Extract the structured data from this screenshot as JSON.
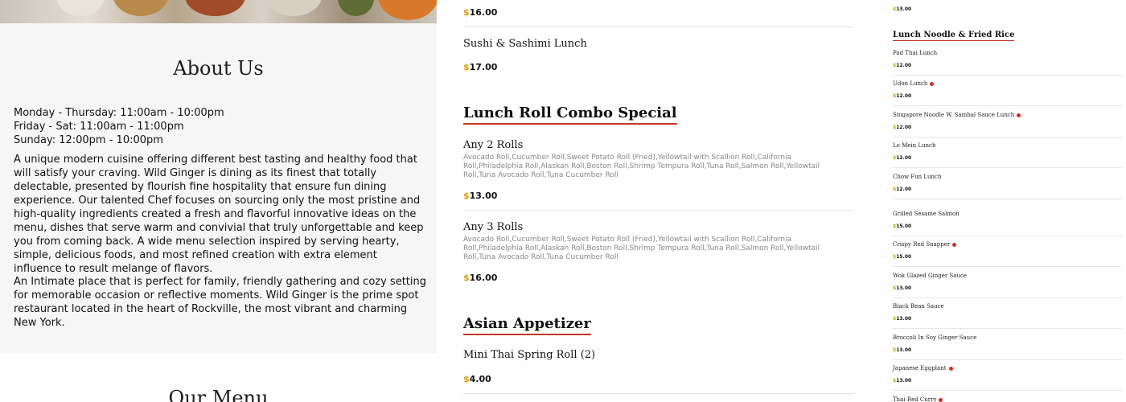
{
  "about": {
    "title": "About Us",
    "hours": [
      "Monday - Thursday: 11:00am - 10:00pm",
      "Friday - Sat: 11:00am - 11:00pm",
      "Sunday: 12:00pm - 10:00pm"
    ],
    "paragraph1": "A unique modern cuisine offering different best tasting and healthy food that will satisfy your craving. Wild Ginger is dining as its finest that totally delectable, presented by flourish fine hospitality that ensure fun dining experience. Our talented Chef focuses on sourcing only the most pristine and high-quality ingredients created a fresh and flavorful innovative ideas on the menu, dishes that serve warm and convivial that truly unforgettable and keep you from coming back. A wide menu selection inspired by serving hearty, simple, delicious foods, and most refined creation with extra element influence to result melange of flavors.",
    "paragraph2": "An Intimate place that is perfect for family, friendly gathering and cozy setting for memorable occasion or reflective moments. Wild Ginger is the prime spot restaurant located in the heart of Rockville, the most vibrant and charming New York."
  },
  "our_menu_title": "Our Menu",
  "currency": "$",
  "middle": {
    "top_price": "16.00",
    "sushi_item": {
      "name": "Sushi & Sashimi Lunch",
      "price": "17.00"
    },
    "roll_combo": {
      "title": "Lunch Roll Combo Special",
      "items": [
        {
          "name": "Any 2 Rolls",
          "desc": "Avocado Roll,Cucumber Roll,Sweet Potato Roll (Fried),Yellowtail with Scallion Roll,California Roll,Philadelphia Roll,Alaskan Roll,Boston Roll,Shrimp Tempura Roll,Tuna Roll,Salmon Roll,Yellowtail Roll,Tuna Avocado Roll,Tuna Cucumber Roll",
          "price": "13.00"
        },
        {
          "name": "Any 3 Rolls",
          "desc": "Avocado Roll,Cucumber Roll,Sweet Potato Roll (Fried),Yellowtail with Scallion Roll,California Roll,Philadelphia Roll,Alaskan Roll,Boston Roll,Shrimp Tempura Roll,Tuna Roll,Salmon Roll,Yellowtail Roll,Tuna Avocado Roll,Tuna Cucumber Roll",
          "price": "16.00"
        }
      ]
    },
    "appetizer": {
      "title": "Asian Appetizer",
      "items": [
        {
          "name": "Mini Thai Spring Roll (2)",
          "price": "4.00"
        }
      ]
    }
  },
  "right": {
    "top_price": "13.00",
    "section_title": "Lunch Noodle & Fried Rice",
    "items": [
      {
        "name": "Pad Thai Lunch",
        "price": "12.00",
        "spicy": false
      },
      {
        "name": "Udon Lunch",
        "price": "12.00",
        "spicy": true
      },
      {
        "name": "Singapore Noodle W. Sambal Sauce Lunch",
        "price": "12.00",
        "spicy": true
      },
      {
        "name": "Lo Mein Lunch",
        "price": "12.00",
        "spicy": false
      },
      {
        "name": "Chow Fun Lunch",
        "price": "12.00",
        "spicy": false
      },
      {
        "name": "Grilled Sesame Salmon",
        "price": "15.00",
        "spicy": false
      },
      {
        "name": "Crispy Red Snapper",
        "price": "15.00",
        "spicy": true
      },
      {
        "name": "Wok Glazed Ginger Sauce",
        "price": "13.00",
        "spicy": false
      },
      {
        "name": "Black Bean Sauce",
        "price": "13.00",
        "spicy": false
      },
      {
        "name": "Broccoli In Soy Ginger Sauce",
        "price": "13.00",
        "spicy": false
      },
      {
        "name": "Japanese Eggplant",
        "price": "13.00",
        "spicy": true
      },
      {
        "name": "Thai Red Curry",
        "price": "",
        "spicy": true
      }
    ]
  },
  "colors": {
    "accent_red": "#c0392b",
    "price_gold": "#d4a017",
    "about_bg": "#f6f6f6",
    "spicy_icon": "#d62d20"
  }
}
